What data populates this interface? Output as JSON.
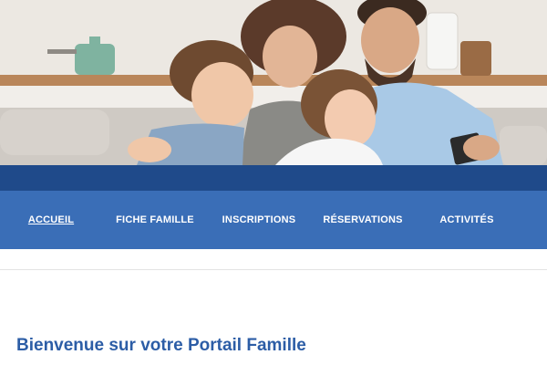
{
  "hero": {
    "image": "family-on-sofa-photo"
  },
  "nav": {
    "items": [
      {
        "label": "ACCUEIL",
        "active": true
      },
      {
        "label": "FICHE FAMILLE",
        "active": false
      },
      {
        "label": "INSCRIPTIONS",
        "active": false
      },
      {
        "label": "RÉSERVATIONS",
        "active": false
      },
      {
        "label": "ACTIVITÉS",
        "active": false
      }
    ]
  },
  "main": {
    "heading": "Bienvenue sur votre Portail Famille"
  },
  "colors": {
    "band": "#1f4a8a",
    "nav": "#3a6eb7",
    "heading": "#2c5da6"
  }
}
